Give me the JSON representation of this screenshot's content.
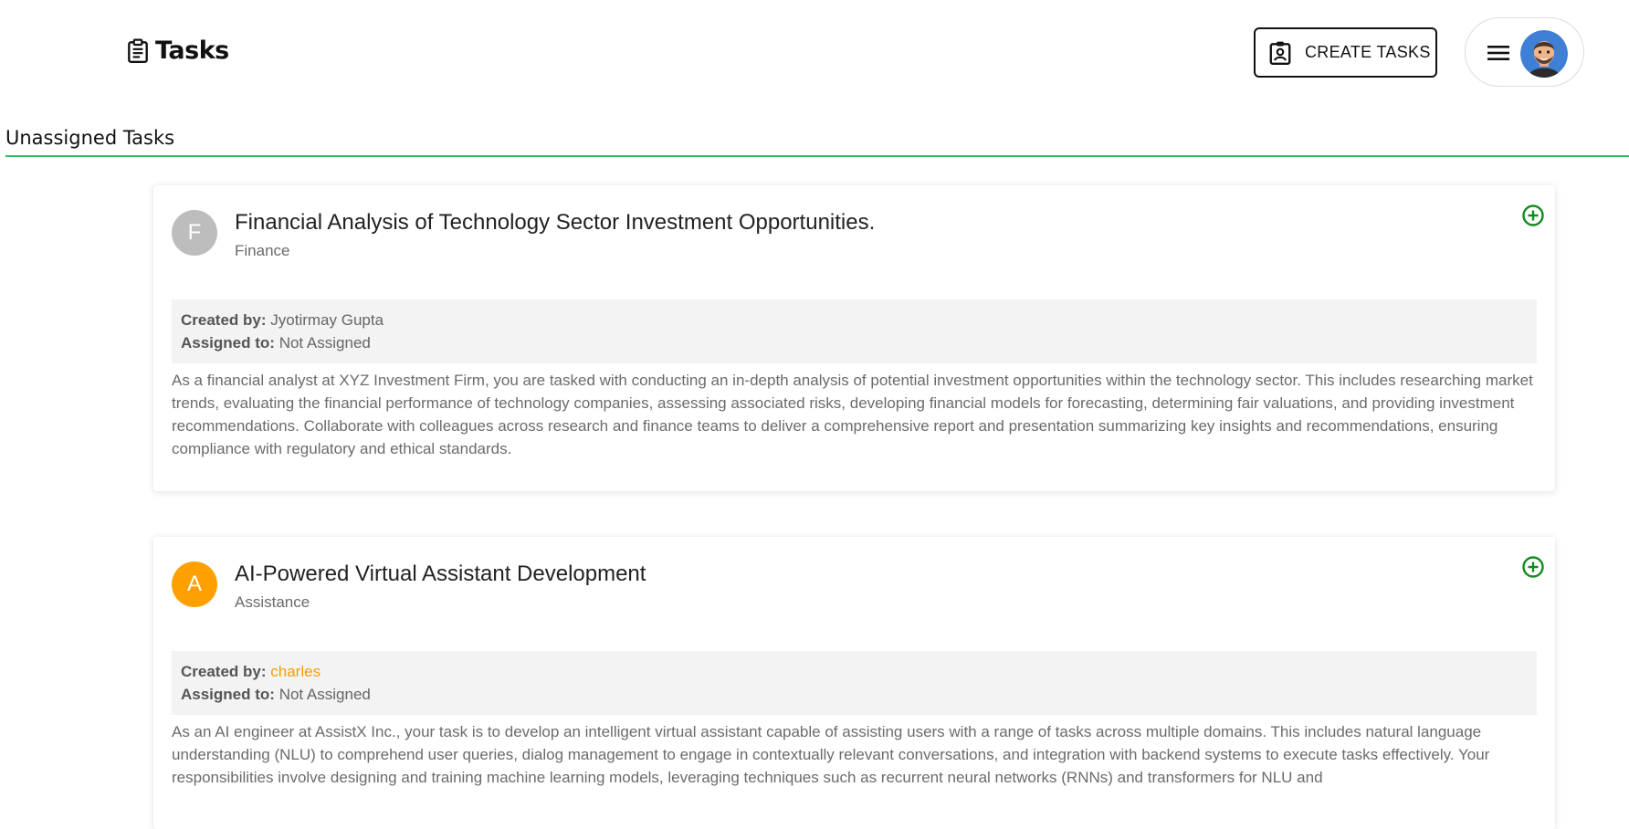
{
  "header": {
    "title": "Tasks",
    "create_button_label": "CREATE TASKS"
  },
  "section": {
    "title": "Unassigned Tasks",
    "accent_color": "#22c55e"
  },
  "tasks": [
    {
      "avatar_letter": "F",
      "avatar_color": "#bdbdbd",
      "title": "Financial Analysis of Technology Sector Investment Opportunities.",
      "category": "Finance",
      "created_by_label": "Created by:",
      "created_by": "Jyotirmay Gupta",
      "assigned_to_label": "Assigned to:",
      "assigned_to": "Not Assigned",
      "description": "As a financial analyst at XYZ Investment Firm, you are tasked with conducting an in-depth analysis of potential investment opportunities within the technology sector. This includes researching market trends, evaluating the financial performance of technology companies, assessing associated risks, developing financial models for forecasting, determining fair valuations, and providing investment recommendations. Collaborate with colleagues across research and finance teams to deliver a comprehensive report and presentation summarizing key insights and recommendations, ensuring compliance with regulatory and ethical standards."
    },
    {
      "avatar_letter": "A",
      "avatar_color": "#ffa000",
      "title": "AI-Powered Virtual Assistant Development",
      "category": "Assistance",
      "created_by_label": "Created by:",
      "created_by": "charles",
      "assigned_to_label": "Assigned to:",
      "assigned_to": "Not Assigned",
      "description": "As an AI engineer at AssistX Inc., your task is to develop an intelligent virtual assistant capable of assisting users with a range of tasks across multiple domains. This includes natural language understanding (NLU) to comprehend user queries, dialog management to engage in contextually relevant conversations, and integration with backend systems to execute tasks effectively. Your responsibilities involve designing and training machine learning models, leveraging techniques such as recurrent neural networks (RNNs) and transformers for NLU and"
    }
  ],
  "icons": {
    "brand": "clipboard-icon",
    "create": "assignment-ind-icon",
    "menu": "menu-icon",
    "add": "add-circle-icon"
  }
}
